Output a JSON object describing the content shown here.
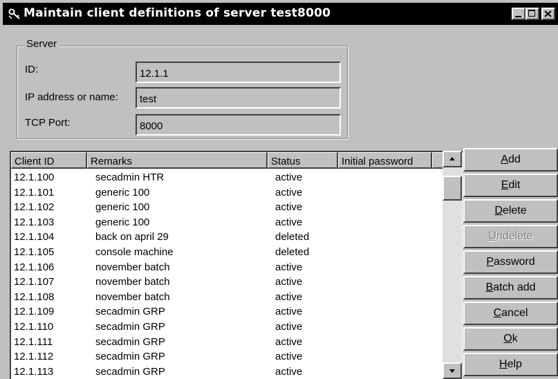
{
  "window": {
    "title": "Maintain client definitions of server test8000"
  },
  "server": {
    "legend": "Server",
    "id_label": "ID:",
    "id_value": "12.1.1",
    "ip_label": "IP address or name:",
    "ip_value": "test",
    "port_label": "TCP Port:",
    "port_value": "8000"
  },
  "list": {
    "columns": [
      "Client ID",
      "Remarks",
      "Status",
      "Initial password"
    ],
    "rows": [
      {
        "id": "12.1.100",
        "remarks": "secadmin HTR",
        "status": "active",
        "password": ""
      },
      {
        "id": "12.1.101",
        "remarks": "generic 100",
        "status": "active",
        "password": ""
      },
      {
        "id": "12.1.102",
        "remarks": "generic 100",
        "status": "active",
        "password": ""
      },
      {
        "id": "12.1.103",
        "remarks": "generic 100",
        "status": "active",
        "password": ""
      },
      {
        "id": "12.1.104",
        "remarks": "back on april 29",
        "status": "deleted",
        "password": ""
      },
      {
        "id": "12.1.105",
        "remarks": "console machine",
        "status": "deleted",
        "password": ""
      },
      {
        "id": "12.1.106",
        "remarks": "november batch",
        "status": "active",
        "password": ""
      },
      {
        "id": "12.1.107",
        "remarks": "november batch",
        "status": "active",
        "password": ""
      },
      {
        "id": "12.1.108",
        "remarks": "november batch",
        "status": "active",
        "password": ""
      },
      {
        "id": "12.1.109",
        "remarks": "secadmin GRP",
        "status": "active",
        "password": ""
      },
      {
        "id": "12.1.110",
        "remarks": "secadmin GRP",
        "status": "active",
        "password": ""
      },
      {
        "id": "12.1.111",
        "remarks": "secadmin GRP",
        "status": "active",
        "password": ""
      },
      {
        "id": "12.1.112",
        "remarks": "secadmin GRP",
        "status": "active",
        "password": ""
      },
      {
        "id": "12.1.113",
        "remarks": "secadmin GRP",
        "status": "active",
        "password": ""
      }
    ],
    "scroll_position": 0.05
  },
  "buttons": [
    {
      "key": "add",
      "mnemonic": "A",
      "rest": "dd",
      "disabled": false
    },
    {
      "key": "edit",
      "mnemonic": "E",
      "rest": "dit",
      "disabled": false
    },
    {
      "key": "delete",
      "mnemonic": "D",
      "rest": "elete",
      "disabled": false
    },
    {
      "key": "undelete",
      "mnemonic": "U",
      "rest": "ndelete",
      "disabled": true
    },
    {
      "key": "password",
      "mnemonic": "P",
      "rest": "assword",
      "disabled": false
    },
    {
      "key": "batch-add",
      "mnemonic": "B",
      "rest": "atch add",
      "disabled": false
    },
    {
      "key": "cancel",
      "mnemonic": "C",
      "rest": "ancel",
      "disabled": false
    },
    {
      "key": "ok",
      "mnemonic": "O",
      "rest": "k",
      "disabled": false
    },
    {
      "key": "help",
      "mnemonic": "H",
      "rest": "elp",
      "disabled": false
    }
  ],
  "icons": {
    "title_icon": "key-icon",
    "minimize": "minimize-icon",
    "maximize": "maximize-icon",
    "close": "close-icon",
    "scroll_up": "arrow-up-icon",
    "scroll_down": "arrow-down-icon"
  }
}
